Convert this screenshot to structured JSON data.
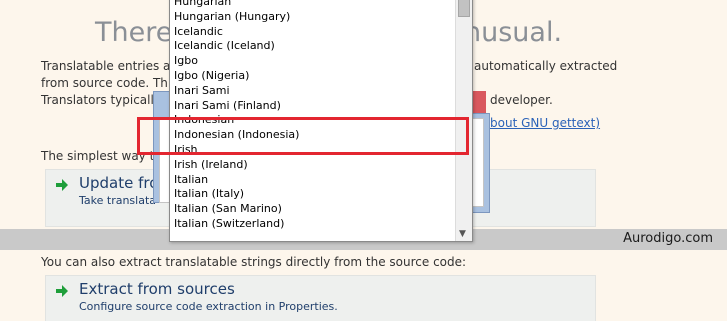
{
  "title": {
    "left": "There a",
    "right": "nusual."
  },
  "paragraph": {
    "line1_left": "Translatable entries ar",
    "line1_right": "automatically extracted",
    "line2_left": "from source code. This",
    "line3_left": "Translators typically",
    "line3_right": "developer.",
    "link": "bout GNU gettext)"
  },
  "simplest_text": "The simplest way to",
  "update_card": {
    "title": "Update fro",
    "subtitle": "Take translata"
  },
  "extract_intro": "You can also extract translatable strings directly from the source code:",
  "extract_card": {
    "title": "Extract from sources",
    "subtitle": "Configure source code extraction in Properties."
  },
  "watermark": "Aurodigo.com",
  "dropdown": {
    "items": [
      "Hungarian",
      "Hungarian (Hungary)",
      "Icelandic",
      "Icelandic (Iceland)",
      "Igbo",
      "Igbo (Nigeria)",
      "Inari Sami",
      "Inari Sami (Finland)",
      "Indonesian",
      "Indonesian (Indonesia)",
      "Irish",
      "Irish (Ireland)",
      "Italian",
      "Italian (Italy)",
      "Italian (San Marino)",
      "Italian (Switzerland)"
    ]
  },
  "colors": {
    "highlight": "#e32630",
    "arrow": "#1e9e3a",
    "link": "#2b62b8"
  }
}
